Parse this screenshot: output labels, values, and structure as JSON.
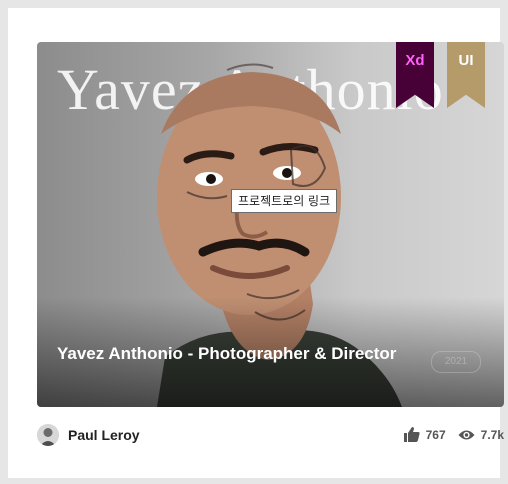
{
  "card": {
    "background_title": "Yavez Anthonio",
    "project_title": "Yavez Anthonio - Photographer & Director",
    "tooltip": "프로젝트로의 링크",
    "year": "2021",
    "badges": [
      {
        "label": "Xd",
        "color": "#470137",
        "text_color": "#ff61f6"
      },
      {
        "label": "UI",
        "color": "#b59a6a",
        "text_color": "#ffffff"
      }
    ]
  },
  "footer": {
    "author": "Paul Leroy",
    "likes": "767",
    "views": "7.7k"
  },
  "icons": {
    "like": "thumbs-up-icon",
    "views": "eye-icon",
    "avatar": "avatar"
  }
}
